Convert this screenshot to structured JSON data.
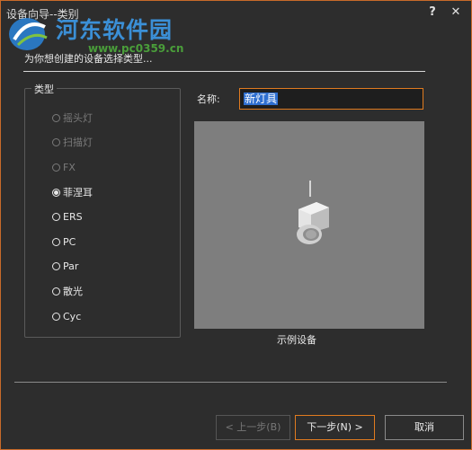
{
  "window": {
    "title": "设备向导--类别",
    "help_glyph": "?",
    "close_glyph": "✕"
  },
  "watermark": {
    "text": "河东软件园",
    "url": "www.pc0359.cn"
  },
  "prompt": "为你想创建的设备选择类型...",
  "type_group": {
    "label": "类型",
    "options": [
      {
        "label": "摇头灯",
        "enabled": false,
        "checked": false
      },
      {
        "label": "扫描灯",
        "enabled": false,
        "checked": false
      },
      {
        "label": "FX",
        "enabled": false,
        "checked": false
      },
      {
        "label": "菲涅耳",
        "enabled": true,
        "checked": true
      },
      {
        "label": "ERS",
        "enabled": true,
        "checked": false
      },
      {
        "label": "PC",
        "enabled": true,
        "checked": false
      },
      {
        "label": "Par",
        "enabled": true,
        "checked": false
      },
      {
        "label": "散光",
        "enabled": true,
        "checked": false
      },
      {
        "label": "Cyc",
        "enabled": true,
        "checked": false
      }
    ]
  },
  "name_field": {
    "label": "名称:",
    "value": "新灯具"
  },
  "preview": {
    "caption": "示例设备"
  },
  "buttons": {
    "prev": "< 上一步(B)",
    "next": "下一步(N) >",
    "cancel": "取消"
  },
  "colors": {
    "accent": "#e07b20",
    "selection": "#2f6fd0",
    "background": "#2d2d2d"
  }
}
